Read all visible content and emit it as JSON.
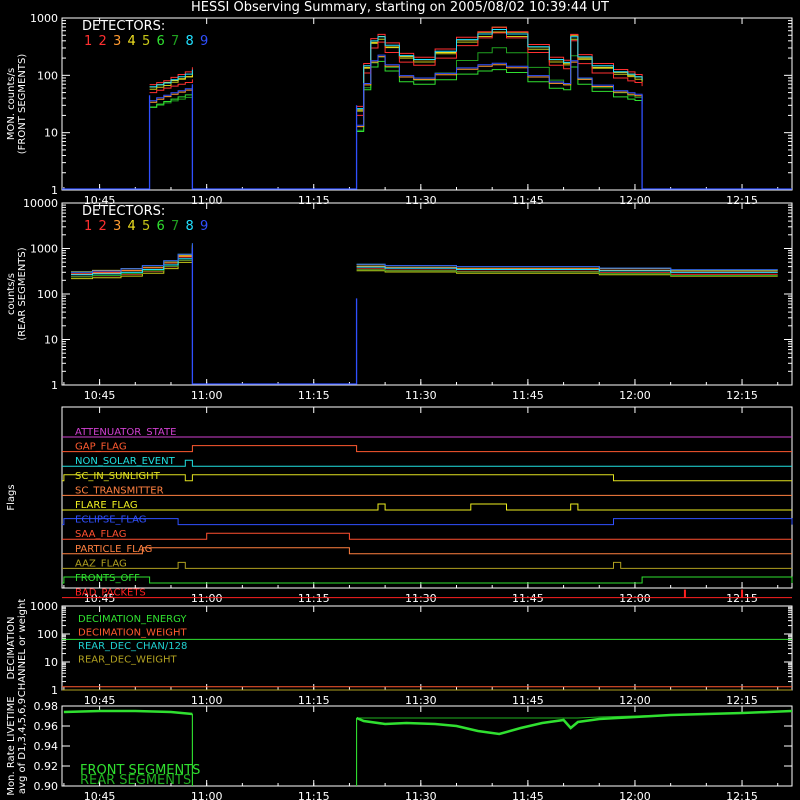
{
  "title": "HESSI Observing Summary, starting on 2005/08/02 10:39:44 UT",
  "colors": {
    "det": [
      "#ff3030",
      "#ff3030",
      "#ff9a30",
      "#f0e020",
      "#c8c818",
      "#30e030",
      "#20a020",
      "#20e0ff",
      "#3050ff"
    ],
    "attenuator": "#d040d0",
    "gap": "#ff5a30",
    "non_solar": "#20e0e0",
    "sunlight": "#e0e020",
    "transmitter": "#ff8040",
    "flare": "#f0f020",
    "eclipse": "#3050ff",
    "saa": "#ff5030",
    "particle": "#ff8040",
    "aaz": "#b0a020",
    "fronts_off": "#30e030",
    "bad_packets": "#ff2020",
    "dec_energy": "#30e030",
    "dec_weight": "#ff5a30",
    "rear_chan": "#20d0d0",
    "rear_weight": "#b0a020",
    "livetime_front": "#30e030",
    "livetime_rear": "#20b020"
  },
  "chart_data": [
    {
      "type": "line",
      "panel": "front",
      "ylabel": "MON. counts/s\n(FRONT SEGMENTS)",
      "yscale": "log",
      "ylim": [
        1,
        1000
      ],
      "yticks": [
        "1",
        "10",
        "100",
        "1000"
      ],
      "xticks": [
        "10:45",
        "11:00",
        "11:15",
        "11:30",
        "11:45",
        "12:00",
        "12:15"
      ],
      "legend_title": "DETECTORS:",
      "legend_items": [
        "1",
        "2",
        "3",
        "4",
        "5",
        "6",
        "7",
        "8",
        "9"
      ],
      "x": [
        "10:52",
        "10:53",
        "10:54",
        "10:55",
        "10:56",
        "10:57",
        "10:58",
        "11:21",
        "11:22",
        "11:23",
        "11:24",
        "11:25",
        "11:27",
        "11:29",
        "11:32",
        "11:35",
        "11:38",
        "11:40",
        "11:42",
        "11:45",
        "11:48",
        "11:50",
        "11:51",
        "11:52",
        "11:54",
        "11:57",
        "11:59",
        "12:00",
        "12:01"
      ],
      "series": [
        {
          "values": [
            50,
            55,
            60,
            65,
            70,
            75,
            85,
            20,
            110,
            300,
            380,
            250,
            170,
            150,
            200,
            330,
            450,
            550,
            450,
            250,
            150,
            130,
            400,
            160,
            110,
            90,
            80,
            75,
            65
          ]
        },
        {
          "values": [
            60,
            65,
            70,
            80,
            90,
            100,
            120,
            25,
            140,
            380,
            450,
            320,
            210,
            180,
            250,
            400,
            500,
            600,
            500,
            300,
            180,
            160,
            450,
            200,
            140,
            110,
            100,
            90,
            80
          ]
        },
        {
          "values": [
            40,
            45,
            50,
            55,
            60,
            65,
            70,
            15,
            80,
            200,
            250,
            170,
            110,
            100,
            120,
            150,
            170,
            180,
            160,
            110,
            85,
            80,
            200,
            100,
            75,
            60,
            55,
            52,
            45
          ]
        }
      ]
    },
    {
      "type": "line",
      "panel": "rear",
      "ylabel": "counts/s\n(REAR SEGMENTS)",
      "yscale": "log",
      "ylim": [
        1,
        10000
      ],
      "yticks": [
        "1",
        "10",
        "100",
        "1000",
        "10000"
      ],
      "xticks": [
        "10:45",
        "11:00",
        "11:15",
        "11:30",
        "11:45",
        "12:00",
        "12:15"
      ],
      "legend_title": "DETECTORS:",
      "legend_items": [
        "1",
        "2",
        "3",
        "4",
        "5",
        "6",
        "7",
        "8",
        "9"
      ],
      "x": [
        "10:41",
        "10:44",
        "10:48",
        "10:51",
        "10:54",
        "10:56",
        "10:58",
        "11:21",
        "11:25",
        "11:35",
        "11:45",
        "11:55",
        "12:05",
        "12:20"
      ],
      "series": [
        {
          "values": [
            280,
            300,
            330,
            380,
            480,
            650,
            1100,
            400,
            380,
            360,
            360,
            330,
            300,
            300
          ]
        },
        {
          "values": [
            230,
            240,
            260,
            300,
            380,
            520,
            900,
            340,
            320,
            300,
            300,
            280,
            260,
            260
          ]
        },
        {
          "values": [
            300,
            320,
            360,
            420,
            540,
            750,
            1300,
            450,
            420,
            400,
            400,
            370,
            340,
            340
          ]
        }
      ]
    },
    {
      "type": "line",
      "panel": "flags",
      "ylabel": "Flags",
      "xticks": [
        "10:45",
        "11:00",
        "11:15",
        "11:30",
        "11:45",
        "12:00",
        "12:15"
      ],
      "flags": [
        {
          "label": "ATTENUATOR_STATE",
          "key": "attenuator",
          "high": []
        },
        {
          "label": "GAP_FLAG",
          "key": "gap",
          "high": [
            [
              "10:58",
              "11:21"
            ]
          ]
        },
        {
          "label": "NON_SOLAR_EVENT",
          "key": "non_solar",
          "high": [
            [
              "10:57",
              "10:58"
            ]
          ]
        },
        {
          "label": "SC_IN_SUNLIGHT",
          "key": "sunlight",
          "high": [
            [
              "10:40",
              "10:57"
            ],
            [
              "10:58",
              "11:57"
            ]
          ]
        },
        {
          "label": "SC_TRANSMITTER",
          "key": "transmitter",
          "high": []
        },
        {
          "label": "FLARE_FLAG",
          "key": "flare",
          "high": [
            [
              "11:24",
              "11:25"
            ],
            [
              "11:37",
              "11:42"
            ],
            [
              "11:51",
              "11:52"
            ]
          ]
        },
        {
          "label": "ECLIPSE_FLAG",
          "key": "eclipse",
          "high": [
            [
              "10:40",
              "10:56"
            ],
            [
              "11:57",
              "12:22"
            ]
          ]
        },
        {
          "label": "SAA_FLAG",
          "key": "saa",
          "high": [
            [
              "11:00",
              "11:20"
            ]
          ]
        },
        {
          "label": "PARTICLE_FLAG",
          "key": "particle",
          "high": [
            [
              "10:51",
              "11:20"
            ]
          ]
        },
        {
          "label": "AAZ_FLAG",
          "key": "aaz",
          "high": [
            [
              "10:56",
              "10:57"
            ],
            [
              "11:57",
              "11:58"
            ]
          ]
        },
        {
          "label": "FRONTS_OFF",
          "key": "fronts_off",
          "high": [
            [
              "10:40",
              "10:52"
            ],
            [
              "12:01",
              "12:22"
            ]
          ]
        },
        {
          "label": "BAD_PACKETS",
          "key": "bad_packets",
          "high": [
            [
              "12:07",
              "12:07"
            ],
            [
              "12:15",
              "12:15"
            ]
          ]
        }
      ]
    },
    {
      "type": "line",
      "panel": "decimation",
      "ylabel": "DECIMATION\nCHANNEL or weight",
      "yscale": "log",
      "ylim": [
        1,
        1000
      ],
      "yticks": [
        "1",
        "10",
        "100",
        "1000"
      ],
      "xticks": [
        "10:45",
        "11:00",
        "11:15",
        "11:30",
        "11:45",
        "12:00",
        "12:15"
      ],
      "series": [
        {
          "name": "DECIMATION_ENERGY",
          "key": "dec_energy",
          "value": 64
        },
        {
          "name": "DECIMATION_WEIGHT",
          "key": "dec_weight",
          "value": 1.3
        },
        {
          "name": "REAR_DEC_CHAN/128",
          "key": "rear_chan",
          "value": 1
        },
        {
          "name": "REAR_DEC_WEIGHT",
          "key": "rear_weight",
          "value": 1
        }
      ]
    },
    {
      "type": "line",
      "panel": "livetime",
      "ylabel": "Mon. Rate LIVETIME\navg of D1,3,4,5,6,9",
      "ylim": [
        0.9,
        0.98
      ],
      "yticks": [
        "0.90",
        "0.92",
        "0.94",
        "0.96",
        "0.98"
      ],
      "xticks": [
        "10:45",
        "11:00",
        "11:15",
        "11:30",
        "11:45",
        "12:00",
        "12:15"
      ],
      "x": [
        "10:40",
        "10:45",
        "10:50",
        "10:55",
        "10:58",
        "11:21",
        "11:22",
        "11:25",
        "11:28",
        "11:32",
        "11:35",
        "11:38",
        "11:41",
        "11:44",
        "11:47",
        "11:50",
        "11:51",
        "11:52",
        "11:55",
        "12:00",
        "12:05",
        "12:10",
        "12:15",
        "12:22"
      ],
      "series": [
        {
          "name": "FRONT SEGMENTS",
          "key": "livetime_front",
          "values": [
            0.974,
            0.975,
            0.975,
            0.974,
            0.972,
            0.968,
            0.965,
            0.962,
            0.963,
            0.962,
            0.96,
            0.955,
            0.952,
            0.958,
            0.963,
            0.966,
            0.958,
            0.964,
            0.967,
            0.969,
            0.971,
            0.972,
            0.973,
            0.975
          ]
        },
        {
          "name": "REAR SEGMENTS",
          "key": "livetime_rear",
          "values": [
            0.974,
            0.975,
            0.975,
            0.974,
            0.972,
            0.968,
            0.968,
            0.968,
            0.968,
            0.968,
            0.968,
            0.968,
            0.968,
            0.968,
            0.968,
            0.968,
            0.968,
            0.968,
            0.969,
            0.97,
            0.971,
            0.972,
            0.973,
            0.975
          ]
        }
      ]
    }
  ]
}
